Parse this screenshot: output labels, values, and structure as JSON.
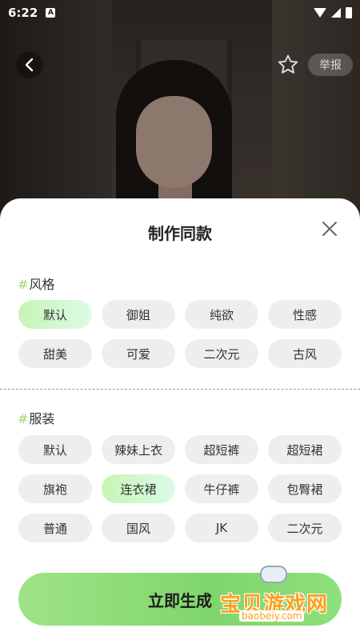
{
  "status_bar": {
    "time": "6:22",
    "badge": "A"
  },
  "nav": {
    "report_label": "举报"
  },
  "sheet": {
    "title": "制作同款",
    "style_section": {
      "label": "风格",
      "options": [
        "默认",
        "御姐",
        "纯欲",
        "性感",
        "甜美",
        "可爱",
        "二次元",
        "古风"
      ],
      "selected": "默认"
    },
    "outfit_section": {
      "label": "服装",
      "options": [
        "默认",
        "辣妹上衣",
        "超短裤",
        "超短裙",
        "旗袍",
        "连衣裙",
        "牛仔裤",
        "包臀裙",
        "普通",
        "国风",
        "JK",
        "二次元"
      ],
      "selected": "连衣裙"
    },
    "generate_label": "立即生成"
  },
  "watermark": {
    "text": "宝贝游戏网",
    "url": "baobeiy.com"
  },
  "colors": {
    "accent_green": "#8ed97a",
    "hash_green": "#a6d86d",
    "watermark_orange": "#ff9f1a"
  }
}
